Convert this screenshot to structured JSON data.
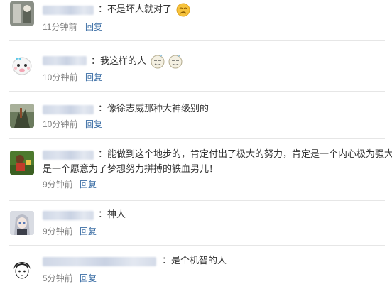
{
  "comments": [
    {
      "text": "：不是坏人就对了",
      "time": "11分钟前",
      "reply": "回复",
      "emoji": [
        "sad-face-emoji"
      ]
    },
    {
      "text": "：我这样的人",
      "time": "10分钟前",
      "reply": "回复",
      "emoji": [
        "tired-face-emoji",
        "tired-face-emoji"
      ]
    },
    {
      "text": "：像徐志威那种大神级别的",
      "time": "10分钟前",
      "reply": "回复",
      "emoji": []
    },
    {
      "text": "：能做到这个地步的，肯定付出了极大的努力，肯定是一个内心极为强大，",
      "text2": "是一个愿意为了梦想努力拼搏的铁血男儿！",
      "time": "9分钟前",
      "reply": "回复",
      "emoji": []
    },
    {
      "text": "：神人",
      "time": "9分钟前",
      "reply": "回复",
      "emoji": []
    },
    {
      "text": "：是个机智的人",
      "time": "5分钟前",
      "reply": "回复",
      "emoji": []
    }
  ]
}
